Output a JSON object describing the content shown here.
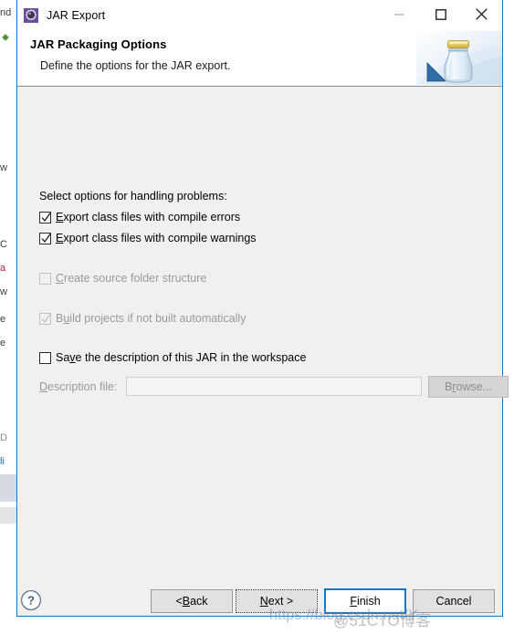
{
  "window": {
    "title": "JAR Export",
    "icon": "jar-export-icon",
    "controls": {
      "minimize": "minimize-icon",
      "maximize": "maximize-icon",
      "close": "close-icon"
    }
  },
  "header": {
    "title": "JAR Packaging Options",
    "description": "Define the options for the JAR export.",
    "banner_icon": "jar-banner-image"
  },
  "body": {
    "group_label": "Select options for handling problems:",
    "options": [
      {
        "label_before": "",
        "mnemonic": "E",
        "label_after": "xport class files with compile errors",
        "checked": true,
        "enabled": true,
        "name": "checkbox-export-compile-errors"
      },
      {
        "label_before": "",
        "mnemonic": "E",
        "label_after": "xport class files with compile warnings",
        "checked": true,
        "enabled": true,
        "name": "checkbox-export-compile-warnings"
      },
      {
        "label_before": "",
        "mnemonic": "C",
        "label_after": "reate source folder structure",
        "checked": false,
        "enabled": false,
        "name": "checkbox-create-source-folder-structure"
      },
      {
        "label_before": "B",
        "mnemonic": "u",
        "label_after": "ild projects if not built automatically",
        "checked": true,
        "enabled": false,
        "name": "checkbox-build-projects-if-not-built"
      },
      {
        "label_before": "Sa",
        "mnemonic": "v",
        "label_after": "e the description of this JAR in the workspace",
        "checked": false,
        "enabled": true,
        "name": "checkbox-save-description"
      }
    ],
    "description_file": {
      "label_before": "",
      "mnemonic": "D",
      "label_after": "escription file:",
      "value": "",
      "placeholder": "",
      "enabled": false,
      "browse_label_before": "B",
      "browse_mnemonic": "r",
      "browse_label_after": "owse..."
    }
  },
  "footer": {
    "help_icon": "help-icon",
    "buttons": [
      {
        "label_before": "< ",
        "mnemonic": "B",
        "label_after": "ack",
        "state": "normal",
        "name": "back-button"
      },
      {
        "label_before": "",
        "mnemonic": "N",
        "label_after": "ext >",
        "state": "focused",
        "name": "next-button"
      },
      {
        "label_before": "",
        "mnemonic": "F",
        "label_after": "inish",
        "state": "default",
        "name": "finish-button"
      },
      {
        "label_before": "Cancel",
        "mnemonic": "",
        "label_after": "",
        "state": "normal",
        "name": "cancel-button"
      }
    ]
  },
  "watermark": {
    "url": "https://blog.csdn.net/Y",
    "brand": "@51CTO博客"
  },
  "background": {
    "fragments": [
      "nd",
      "w",
      "C",
      "a",
      "w",
      "e",
      "e",
      "D",
      "li"
    ]
  },
  "colors": {
    "accent": "#0a78d4",
    "dialog_bg": "#f0f0f0",
    "title_bg": "#ffffff",
    "button_bg": "#e1e1e1",
    "disabled_text": "#9a9a9a"
  }
}
